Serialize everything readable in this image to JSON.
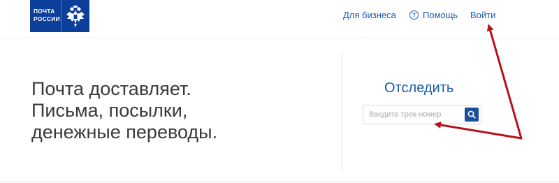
{
  "header": {
    "logo": {
      "line1": "ПОЧТА",
      "line2": "РОССИИ"
    },
    "nav": {
      "business": "Для бизнеса",
      "help": "Помощь",
      "login": "Войти"
    }
  },
  "hero": {
    "line1": "Почта доставляет.",
    "line2": "Письма, посылки,",
    "line3": "денежные переводы."
  },
  "tracking": {
    "title": "Отследить",
    "placeholder": "Введите трек-номер"
  },
  "colors": {
    "brand_blue": "#0b3f9a",
    "link_blue": "#1a5cb0",
    "annotation_red": "#b5121b"
  },
  "icons": {
    "emblem": "double-headed-eagle-icon",
    "help": "question-circle-icon",
    "search": "search-icon"
  }
}
